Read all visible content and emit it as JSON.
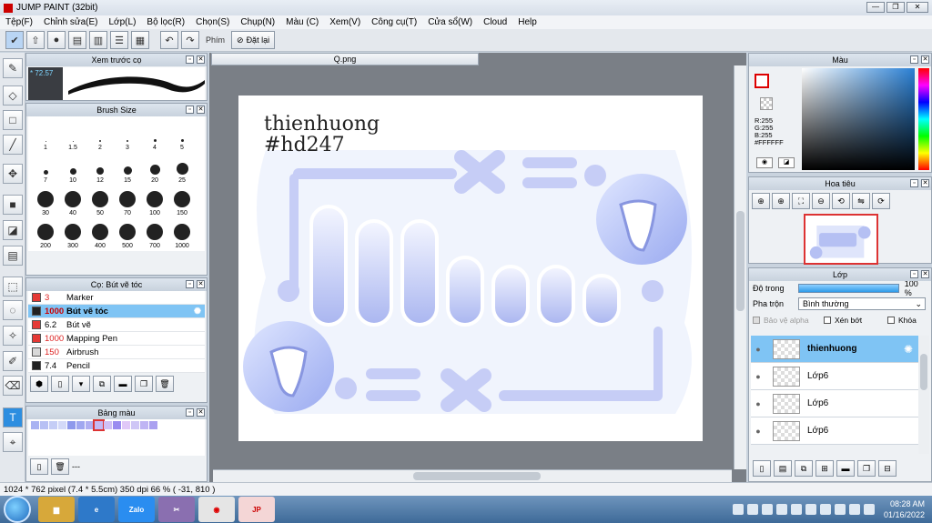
{
  "window": {
    "title": "JUMP PAINT (32bit)",
    "btn_min": "—",
    "btn_max": "❐",
    "btn_close": "✕"
  },
  "menu": [
    "Tệp(F)",
    "Chỉnh sửa(E)",
    "Lớp(L)",
    "Bộ lọc(R)",
    "Chọn(S)",
    "Chụp(N)",
    "Màu (C)",
    "Xem(V)",
    "Công cụ(T)",
    "Cửa sổ(W)",
    "Cloud",
    "Help"
  ],
  "toolbar": {
    "phim_label": "Phím",
    "reset_label": "Đặt lại"
  },
  "brush_preview": {
    "title": "Xem trước cọ",
    "value": "* 72.57"
  },
  "brush_size": {
    "title": "Brush Size",
    "sizes": [
      "1",
      "1.5",
      "2",
      "3",
      "4",
      "5",
      "7",
      "10",
      "12",
      "15",
      "20",
      "25",
      "30",
      "40",
      "50",
      "70",
      "100",
      "150",
      "200",
      "300",
      "400",
      "500",
      "700",
      "1000"
    ]
  },
  "brush_panel": {
    "title": "Cọ: Bút vẽ tóc",
    "items": [
      {
        "size": "3",
        "name": "Marker",
        "color": "#e53935"
      },
      {
        "size": "1000",
        "name": "Bút vẽ tóc",
        "color": "#222222"
      },
      {
        "size": "6.2",
        "name": "Bút vẽ",
        "color": "#e53935"
      },
      {
        "size": "1000",
        "name": "Mapping Pen",
        "color": "#e53935"
      },
      {
        "size": "150",
        "name": "Airbrush",
        "color": "#d8d8d8"
      },
      {
        "size": "7.4",
        "name": "Pencil",
        "color": "#222222"
      }
    ]
  },
  "palette": {
    "title": "Bảng màu",
    "footer": "---"
  },
  "document": {
    "tab": "Q.png"
  },
  "artwork": {
    "line1": "thienhuong",
    "line2": "#hd247"
  },
  "color_panel": {
    "title": "Màu",
    "r": "R:255",
    "g": "G:255",
    "b": "B:255",
    "hex": "#FFFFFF"
  },
  "navigator": {
    "title": "Hoa tiêu"
  },
  "layers": {
    "title": "Lớp",
    "opacity_label": "Độ trong",
    "opacity_value": "100 %",
    "blend_label": "Pha trộn",
    "blend_value": "Bình thường",
    "protect_alpha": "Bảo vệ alpha",
    "clip_label": "Xén bớt",
    "lock_label": "Khóa",
    "items": [
      "thienhuong",
      "Lớp6",
      "Lớp6",
      "Lớp6"
    ]
  },
  "status": {
    "text": "1024 * 762 pixel  (7.4 * 5.5cm)  350 dpi  66 %  ( -31, 810 )"
  },
  "taskbar": {
    "apps": [
      "Zalo"
    ],
    "time": "08:28 AM",
    "date": "01/16/2022"
  }
}
